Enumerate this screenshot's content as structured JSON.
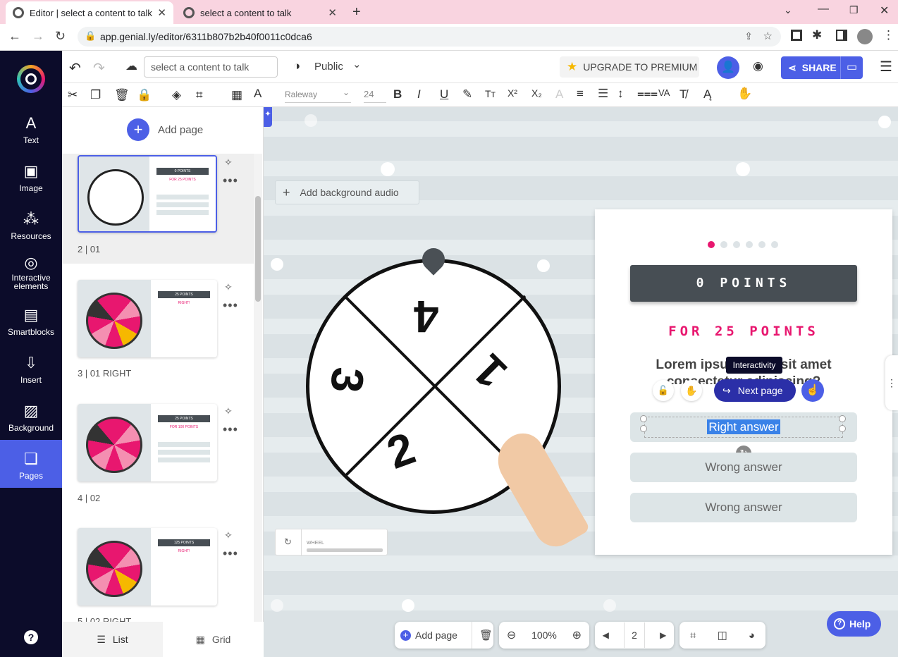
{
  "browser": {
    "tabs": [
      {
        "title": "Editor | select a content to talk"
      },
      {
        "title": "select a content to talk"
      }
    ],
    "url": "app.genial.ly/editor/6311b807b2b40f0011c0dca6"
  },
  "rail": {
    "items": [
      {
        "label": "Text"
      },
      {
        "label": "Image"
      },
      {
        "label": "Resources"
      },
      {
        "label": "Interactive elements"
      },
      {
        "label": "Smartblocks"
      },
      {
        "label": "Insert"
      },
      {
        "label": "Background"
      },
      {
        "label": "Pages"
      }
    ],
    "help": "?"
  },
  "topbar": {
    "title_value": "select a content to talk",
    "visibility": "Public",
    "upgrade_label": "UPGRADE TO PREMIUM",
    "share_label": "SHARE"
  },
  "format": {
    "font": "Raleway",
    "size": "24"
  },
  "panel": {
    "add_page": "Add page",
    "pages": [
      {
        "label": "2 |  01",
        "points": "0 POINTS",
        "sub": "FOR 25 POINTS"
      },
      {
        "label": "3 |  01 RIGHT",
        "points": "25 POINTS",
        "sub": "RIGHT!"
      },
      {
        "label": "4 |  02",
        "points": "25 POINTS",
        "sub": "FOR 100 POINTS"
      },
      {
        "label": "5 |  02 RIGHT",
        "points": "125 POINTS",
        "sub": "RIGHT!"
      }
    ],
    "view_list": "List",
    "view_grid": "Grid"
  },
  "canvas": {
    "add_audio": "Add background audio",
    "wheel_numbers": [
      "4",
      "1",
      "2",
      "3"
    ],
    "wheel_label": "WHEEL",
    "card": {
      "points": "0 POINTS",
      "subtitle": "FOR 25 POINTS",
      "question_line1": "Lorem ipsum dolor sit amet",
      "question_line2": "consectetur adipiscing?",
      "tooltip": "Interactivity",
      "next_page": "Next page",
      "answers": [
        "Right answer",
        "Wrong answer",
        "Wrong answer"
      ]
    }
  },
  "bottom": {
    "add_page": "Add page",
    "zoom": "100%",
    "page_number": "2",
    "help": "Help"
  },
  "colors": {
    "accent": "#4c5fe6",
    "pink": "#e8176f",
    "dark": "#474e54",
    "rail": "#0c0c2a"
  }
}
